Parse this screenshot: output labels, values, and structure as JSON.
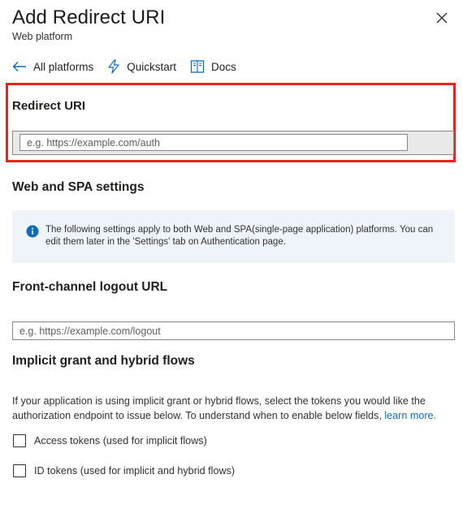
{
  "header": {
    "title": "Add Redirect URI",
    "subtitle": "Web platform"
  },
  "toolbar": {
    "all_platforms": "All platforms",
    "quickstart": "Quickstart",
    "docs": "Docs"
  },
  "redirect_uri": {
    "heading": "Redirect URI",
    "placeholder": "e.g. https://example.com/auth",
    "value": ""
  },
  "web_spa": {
    "heading": "Web and SPA settings",
    "info_text": "The following settings apply to both Web and SPA(single-page application) platforms. You can edit them later in the 'Settings' tab on Authentication page."
  },
  "logout": {
    "heading": "Front-channel logout URL",
    "placeholder": "e.g. https://example.com/logout",
    "value": ""
  },
  "implicit": {
    "heading": "Implicit grant and hybrid flows",
    "description": "If your application is using implicit grant or hybrid flows, select the tokens you would like the authorization endpoint to issue below. To understand when to enable below fields, ",
    "learn_more": "learn more.",
    "options": [
      {
        "label": "Access tokens (used for implicit flows)",
        "checked": false
      },
      {
        "label": "ID tokens (used for implicit and hybrid flows)",
        "checked": false
      }
    ]
  },
  "colors": {
    "highlight": "#e8231b",
    "accent": "#0f6cbd",
    "info_bg": "#eff4fb"
  },
  "icons": {
    "close": "close-icon",
    "back": "arrow-left-icon",
    "quickstart": "lightning-icon",
    "docs": "book-icon",
    "info": "info-icon"
  }
}
